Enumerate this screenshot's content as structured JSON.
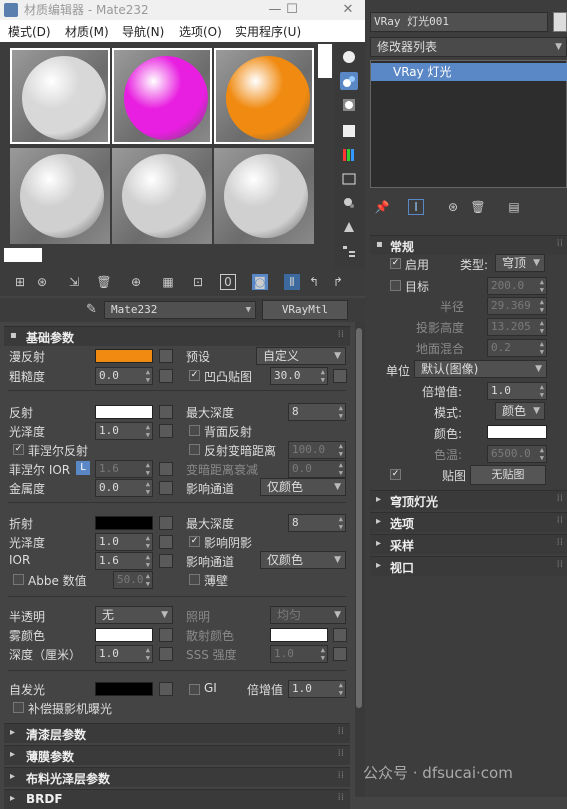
{
  "window": {
    "title": "材质编辑器 - Mate232",
    "min": "—",
    "max": "☐",
    "close": "✕"
  },
  "menu": [
    "模式(D)",
    "材质(M)",
    "导航(N)",
    "选项(O)",
    "实用程序(U)"
  ],
  "material_name": "Mate232",
  "material_type": "VRayMtl",
  "slots": [
    {
      "color": "#d8d8d8",
      "selected": true
    },
    {
      "color": "#e81ee0",
      "selected": true
    },
    {
      "color": "#f08a10",
      "selected": true
    },
    {
      "color": "#d0d0d0",
      "selected": false
    },
    {
      "color": "#d0d0d0",
      "selected": false
    },
    {
      "color": "#d0d0d0",
      "selected": false
    }
  ],
  "sections": {
    "basic": "基础参数",
    "coat": "清漆层参数",
    "sheen": "薄膜参数",
    "cloth": "布料光泽层参数",
    "brdf": "BRDF"
  },
  "diffuse": {
    "label": "漫反射",
    "color": "#f08a10",
    "preset_label": "预设",
    "preset": "自定义"
  },
  "roughness": {
    "label": "粗糙度",
    "value": "0.0",
    "bump_label": "凹凸贴图",
    "bump": "30.0"
  },
  "reflect": {
    "label": "反射",
    "color": "#ffffff",
    "max_depth_label": "最大深度",
    "max_depth": "8",
    "gloss_label": "光泽度",
    "gloss": "1.0",
    "back_label": "背面反射",
    "fresnel_label": "菲涅尔反射",
    "dim_label": "反射变暗距离",
    "dim": "100.0",
    "ior_label": "菲涅尔 IOR",
    "ior_lock": "L",
    "ior": "1.6",
    "falloff_label": "变暗距离衰减",
    "falloff": "0.0",
    "metal_label": "金属度",
    "metal": "0.0",
    "affect_label": "影响通道",
    "affect": "仅颜色"
  },
  "refract": {
    "label": "折射",
    "color": "#000000",
    "max_depth_label": "最大深度",
    "max_depth": "8",
    "gloss_label": "光泽度",
    "gloss": "1.0",
    "shadow_label": "影响阴影",
    "ior_label": "IOR",
    "ior": "1.6",
    "affect_label": "影响通道",
    "affect": "仅颜色",
    "abbe_label": "Abbe 数值",
    "abbe": "50.0",
    "thin_label": "薄壁"
  },
  "translucency": {
    "label": "半透明",
    "value": "无",
    "light_label": "照明",
    "light": "均匀",
    "fog_label": "雾颜色",
    "fog_color": "#ffffff",
    "scatter_label": "散射颜色",
    "scatter_color": "#ffffff",
    "depth_label": "深度（厘米）",
    "depth": "1.0",
    "sss_label": "SSS 强度",
    "sss": "1.0"
  },
  "selfillum": {
    "label": "自发光",
    "color": "#000000",
    "gi_label": "GI",
    "mult_label": "倍增值",
    "mult": "1.0",
    "comp_label": "补偿摄影机曝光"
  },
  "right": {
    "object_name": "VRay 灯光001",
    "modifier_list": "修改器列表",
    "stack_item": "VRay 灯光",
    "general": "常规",
    "on_label": "启用",
    "type_label": "类型:",
    "type": "穹顶",
    "target_label": "目标",
    "target": "200.0",
    "radius_label": "半径",
    "radius": "29.369",
    "proj_label": "投影高度",
    "proj": "13.205",
    "ground_label": "地面混合",
    "ground": "0.2",
    "unit_label": "单位",
    "unit": "默认(图像)",
    "mult_label": "倍增值:",
    "mult": "1.0",
    "mode_label": "模式:",
    "mode": "颜色",
    "color_label": "颜色:",
    "color": "#ffffff",
    "temp_label": "色温:",
    "temp": "6500.0",
    "map_label": "贴图",
    "map": "无贴图",
    "rollouts": [
      "穹顶灯光",
      "选项",
      "采样",
      "视口"
    ]
  },
  "watermark": "公众号 · dfsucai·com"
}
